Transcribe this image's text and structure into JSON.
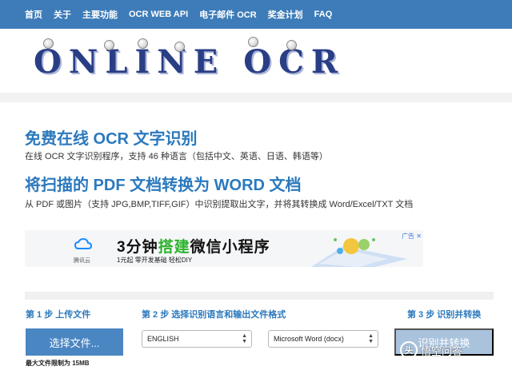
{
  "nav": {
    "items": [
      "首页",
      "关于",
      "主要功能",
      "OCR WEB API",
      "电子邮件 OCR",
      "奖金计划",
      "FAQ"
    ]
  },
  "logo": {
    "text": "ONLINE OCR"
  },
  "intro": {
    "title": "免费在线 OCR 文字识别",
    "subtitle": "在线 OCR 文字识别程序，支持 46 种语言（包括中文、英语、日语、韩语等）",
    "title2": "将扫描的 PDF 文档转换为 WORD 文档",
    "subtitle2": "从 PDF 或图片（支持 JPG,BMP,TIFF,GIF）中识别提取出文字，并将其转换成 Word/Excel/TXT 文档"
  },
  "ad": {
    "brand": "腾讯云",
    "title_part1": "3分钟",
    "title_highlight": "搭建",
    "title_part2": "微信小程序",
    "slogan": "1元起   零开发基础   轻松DIY",
    "tag": "广告"
  },
  "steps": {
    "step1": "第 1 步 上传文件",
    "step2": "第 2 步 选择识别语言和输出文件格式",
    "step3": "第 3 步 识别并转换",
    "choose_button": "选择文件...",
    "size_limit": "最大文件限制为 15MB",
    "language_value": "ENGLISH",
    "format_value": "Microsoft Word (docx)",
    "convert_button": "识别并转换"
  },
  "watermark": {
    "text": "悟空问答",
    "icon": "头"
  },
  "colors": {
    "nav": "#3d7cb8",
    "heading": "#2b79bd",
    "button": "#4a86c2",
    "button_disabled": "#a9c3dd",
    "ad_green": "#2db32d"
  }
}
